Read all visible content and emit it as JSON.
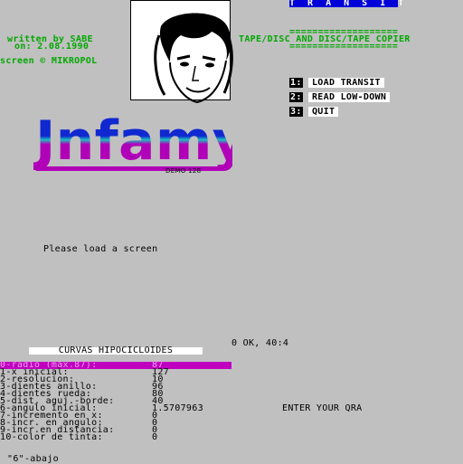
{
  "header": {
    "transit_title": "T R A N S I T",
    "credits": [
      "written by SABE",
      "on: 2.08.1990",
      "screen © MIKROPOL"
    ],
    "copier_lines": [
      "===================",
      "TAPE/DISC AND DISC/TAPE COPIER",
      "==================="
    ]
  },
  "menu": [
    {
      "key": "1:",
      "label": "LOAD TRANSIT"
    },
    {
      "key": "2:",
      "label": "READ LOW-DOWN"
    },
    {
      "key": "3:",
      "label": "QUIT"
    }
  ],
  "logo": {
    "text": "Jnfamy",
    "subtitle": "DEMO 128"
  },
  "prompt": "Please load a screen",
  "status": "0 OK, 40:4",
  "curvas": {
    "title": "CURVAS HIPOCICLOIDES",
    "rows": [
      {
        "label": "0-radio (max.87):",
        "value": "87"
      },
      {
        "label": "1-x inicial:",
        "value": "127"
      },
      {
        "label": "2-resolucion:",
        "value": "10"
      },
      {
        "label": "3-dientes anillo:",
        "value": "96"
      },
      {
        "label": "4-dientes rueda:",
        "value": "80"
      },
      {
        "label": "5-dist. aguj.-borde:",
        "value": "40"
      },
      {
        "label": "6-angulo inicial:",
        "value": "1.5707963"
      },
      {
        "label": "7-incremento en x:",
        "value": "0"
      },
      {
        "label": "8-incr. en angulo:",
        "value": "0"
      },
      {
        "label": "9-incr.en distancia:",
        "value": "0"
      },
      {
        "label": "10-color de tinta:",
        "value": "0"
      }
    ],
    "footer": "\"6\"-abajo"
  },
  "qra_prompt": "ENTER YOUR QRA",
  "colors": {
    "background": "#c0c0c0",
    "green": "#00a800",
    "blue": "#0000d8",
    "magenta": "#c000c0"
  }
}
